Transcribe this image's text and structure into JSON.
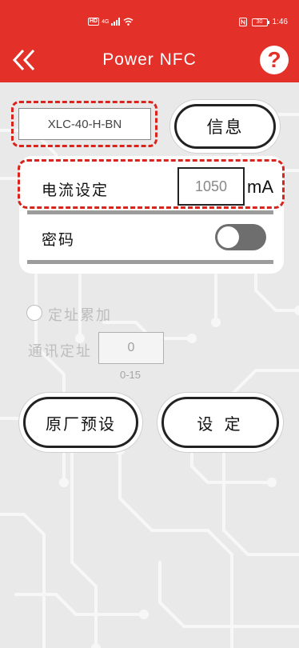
{
  "status_bar": {
    "hd_badge": "HD",
    "network": "4G",
    "battery": "30",
    "time": "1:46"
  },
  "header": {
    "title": "Power NFC",
    "help_label": "?"
  },
  "model": {
    "value": "XLC-40-H-BN",
    "info_button": "信息"
  },
  "settings": {
    "current_label": "电流设定",
    "current_value": "1050",
    "current_unit": "mA",
    "password_label": "密码",
    "password_toggle_on": false
  },
  "addressing": {
    "accumulate_label": "定址累加",
    "address_label": "通讯定址",
    "address_value": "0",
    "address_range": "0-15"
  },
  "actions": {
    "factory_button": "原厂预设",
    "set_button": "设 定"
  },
  "colors": {
    "accent": "#e3312a",
    "highlight_dash": "#d8241c"
  },
  "icons": [
    "signal-icon",
    "wifi-icon",
    "nfc-icon",
    "battery-icon",
    "double-chevron-left-icon",
    "help-icon"
  ]
}
